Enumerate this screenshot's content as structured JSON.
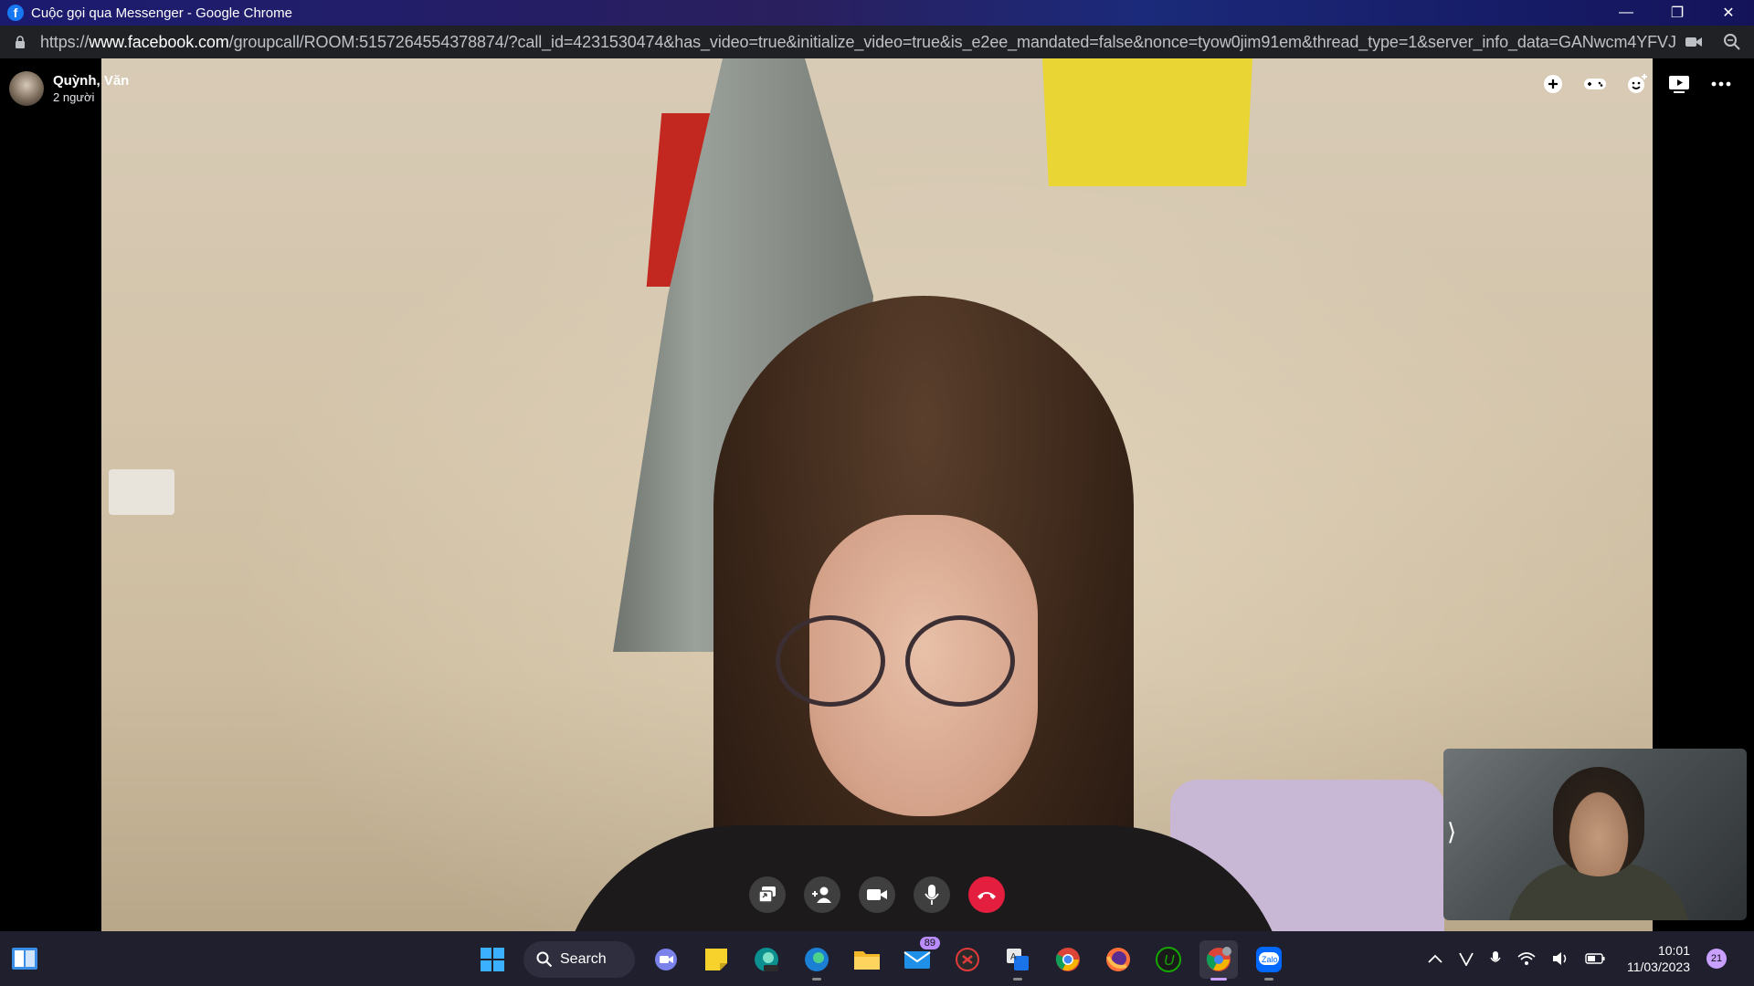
{
  "window": {
    "title": "Cuộc gọi qua Messenger - Google Chrome"
  },
  "address": {
    "prefix": "https://",
    "host": "www.facebook.com",
    "path": "/groupcall/ROOM:5157264554378874/?call_id=4231530474&has_video=true&initialize_video=true&is_e2ee_mandated=false&nonce=tyow0jim91em&thread_type=1&server_info_data=GANwcm4YFVJPT..."
  },
  "call": {
    "names": "Quỳnh, Văn",
    "participants": "2 người",
    "end_color": "#e41e3f"
  },
  "taskbar": {
    "search_label": "Search",
    "mail_badge": "89",
    "zalo_label": "Zalo",
    "time": "10:01",
    "date": "11/03/2023",
    "notification_count": "21"
  }
}
